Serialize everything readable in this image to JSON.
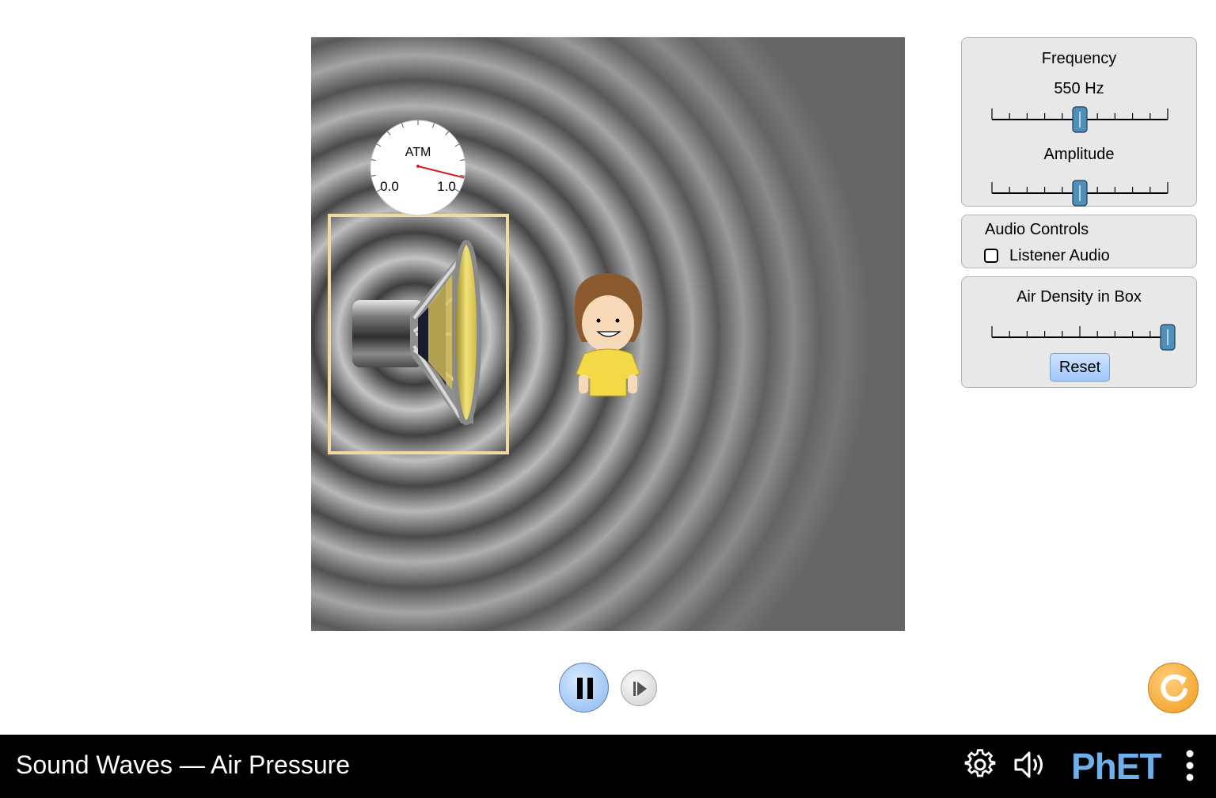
{
  "colors": {
    "slider_thumb": "#4f8fb8",
    "navbar_bg": "#000000",
    "box_outline": "#f0d9a2",
    "needle": "#d62020",
    "reset_all": "#f29a1e",
    "play_button": "#8ab8f0"
  },
  "gauge": {
    "label": "ATM",
    "min_label": "0.0",
    "max_label": "1.0",
    "value": 1.0
  },
  "frequency_panel": {
    "title": "Frequency",
    "value_text": "550 Hz",
    "frequency_fraction": 0.5,
    "amplitude_title": "Amplitude",
    "amplitude_fraction": 0.5
  },
  "audio_panel": {
    "title": "Audio Controls",
    "listener_label": "Listener Audio",
    "listener_checked": false
  },
  "density_panel": {
    "title": "Air Density in Box",
    "density_fraction": 1.0,
    "reset_label": "Reset"
  },
  "playback": {
    "play_pause_icon": "pause-icon",
    "step_icon": "step-forward-icon",
    "reset_all_icon": "reset-all-icon"
  },
  "navbar": {
    "title": "Sound Waves — Air Pressure",
    "settings_icon": "gear-icon",
    "audio_icon": "speaker-icon",
    "logo": "PhET",
    "menu_icon": "kebab-menu-icon"
  }
}
